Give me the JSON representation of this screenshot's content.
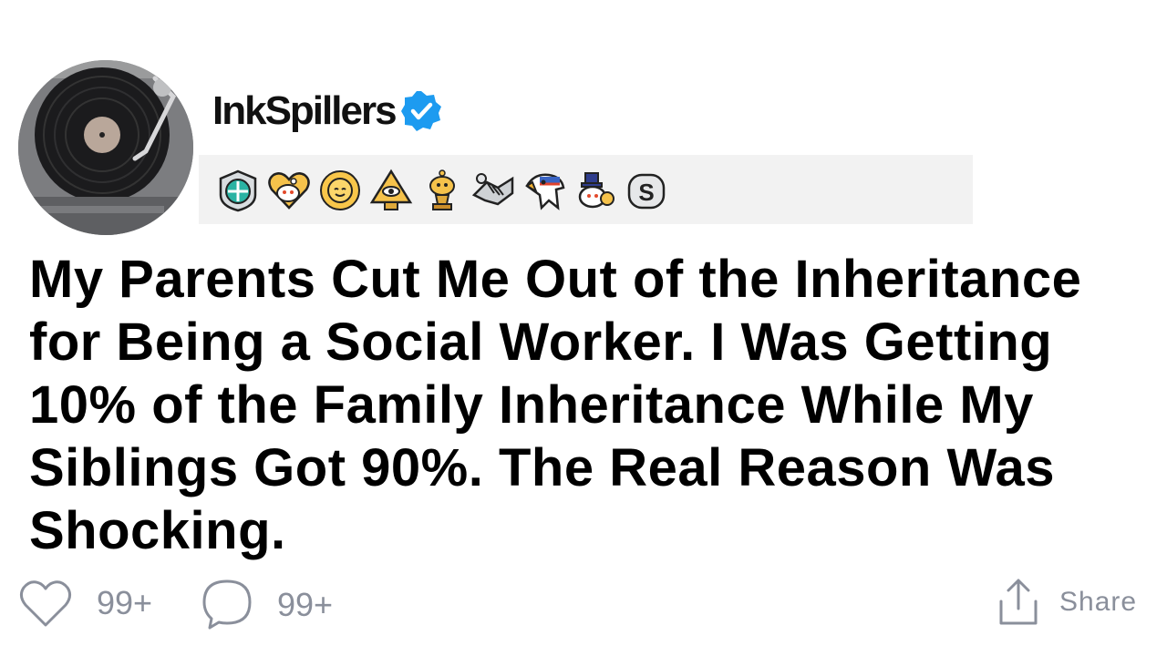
{
  "post": {
    "username": "InkSpillers",
    "verified": true,
    "title": "My Parents Cut Me Out of the Inheritance for Being a Social Worker. I Was Getting 10% of the Family Inheritance While My Siblings Got 90%. The Real Reason Was Shocking."
  },
  "avatar": {
    "icon": "record-player-icon"
  },
  "awards": [
    {
      "icon": "shield-compass-award-icon"
    },
    {
      "icon": "heart-snoo-award-icon"
    },
    {
      "icon": "sun-face-award-icon"
    },
    {
      "icon": "pyramid-eye-award-icon"
    },
    {
      "icon": "gold-trophy-snoo-award-icon"
    },
    {
      "icon": "handshake-award-icon"
    },
    {
      "icon": "eagle-award-icon"
    },
    {
      "icon": "snoo-top-hat-award-icon"
    },
    {
      "icon": "silver-s-award-icon"
    }
  ],
  "actions": {
    "like_count": "99+",
    "comment_count": "99+",
    "share_label": "Share"
  },
  "colors": {
    "verified_blue": "#1d9bf0",
    "action_gray": "#8a8f9b",
    "awards_bar_bg": "#f2f2f2"
  }
}
